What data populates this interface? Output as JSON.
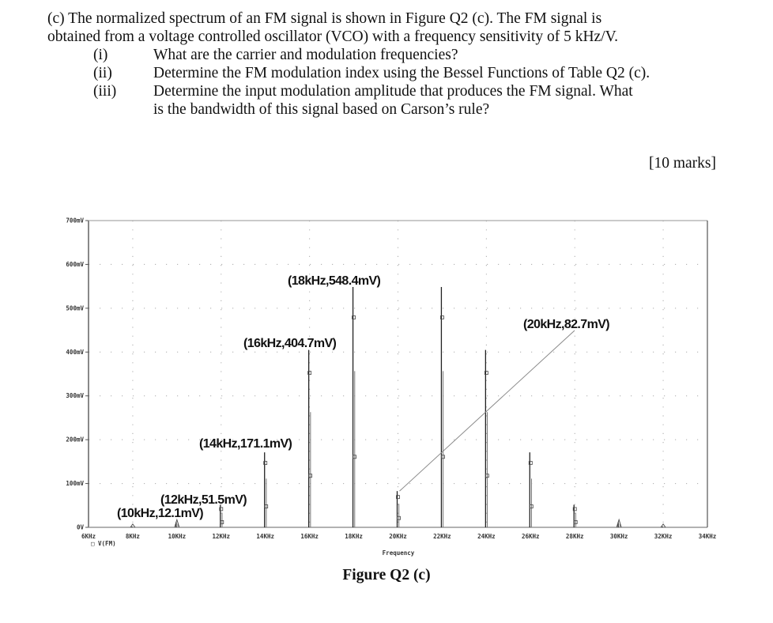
{
  "question": {
    "lines": [
      "(c) The normalized spectrum of an FM signal is shown in Figure Q2 (c).  The FM signal is",
      "obtained from a voltage controlled oscillator (VCO) with a frequency sensitivity of 5 kHz/V."
    ],
    "items": [
      {
        "num": "(i)",
        "lines": [
          "What are the carrier and modulation frequencies?"
        ]
      },
      {
        "num": "(ii)",
        "lines": [
          "Determine the FM modulation index using the Bessel Functions of Table Q2 (c)."
        ]
      },
      {
        "num": "(iii)",
        "lines": [
          "Determine the input modulation amplitude that produces the FM signal.  What",
          "is the bandwidth of this signal based on Carson’s rule?"
        ]
      }
    ],
    "marks": "[10 marks]"
  },
  "figure_caption": "Figure Q2 (c)",
  "chart_data": {
    "type": "bar",
    "title": "",
    "xlabel": "Frequency",
    "ylabel": "",
    "legend": "□ V(FM)",
    "legend_position": "bottom-left",
    "grid": "dotted",
    "xlim": [
      6,
      34
    ],
    "ylim": [
      0,
      700
    ],
    "x_unit": "kHz",
    "y_unit": "mV",
    "x_ticks": [
      "6KHz",
      "8KHz",
      "10KHz",
      "12KHz",
      "14KHz",
      "16KHz",
      "18KHz",
      "20KHz",
      "22KHz",
      "24KHz",
      "26KHz",
      "28KHz",
      "30KHz",
      "32KHz",
      "34KHz"
    ],
    "y_ticks": [
      "0V",
      "100mV",
      "200mV",
      "300mV",
      "400mV",
      "500mV",
      "600mV",
      "700mV"
    ],
    "x": [
      8,
      10,
      12,
      14,
      16,
      18,
      20,
      22,
      24,
      26,
      28,
      30,
      32
    ],
    "values": [
      2,
      12.1,
      51.5,
      171.1,
      404.7,
      548.4,
      82.7,
      548.4,
      404.7,
      171.1,
      51.5,
      12.1,
      2
    ],
    "annotations": [
      {
        "text": "(10kHz,12.1mV)",
        "x": 10,
        "y": 12.1
      },
      {
        "text": "(12kHz,51.5mV)",
        "x": 12,
        "y": 51.5
      },
      {
        "text": "(14kHz,171.1mV)",
        "x": 14,
        "y": 171.1
      },
      {
        "text": "(16kHz,404.7mV)",
        "x": 16,
        "y": 404.7
      },
      {
        "text": "(18kHz,548.4mV)",
        "x": 18,
        "y": 548.4
      },
      {
        "text": "(20kHz,82.7mV)",
        "x": 20,
        "y": 82.7
      }
    ]
  }
}
